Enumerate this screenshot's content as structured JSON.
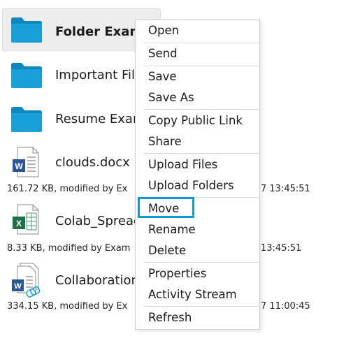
{
  "files": [
    {
      "name": "Folder Examp",
      "type": "folder",
      "selected": true
    },
    {
      "name": "Important File",
      "type": "folder"
    },
    {
      "name": "Resume Exam",
      "type": "folder"
    },
    {
      "name": "clouds.docx",
      "type": "word",
      "meta_left": "161.72 KB, modified by Ex",
      "meta_right": "7 13:45:51"
    },
    {
      "name": "Colab_Spread",
      "type": "excel",
      "meta_left": "8.33 KB, modified by Exam",
      "meta_right": "13:45:51"
    },
    {
      "name": "Collaboration",
      "type": "word-shared",
      "meta_left": "334.15 KB, modified by Ex",
      "meta_right": "7 11:00:45"
    }
  ],
  "context_menu": {
    "items": [
      "Open",
      "Send",
      "Save",
      "Save As",
      "Copy Public Link",
      "Share",
      "Upload Files",
      "Upload Folders",
      "Move",
      "Rename",
      "Delete",
      "Properties",
      "Activity Stream",
      "Refresh"
    ],
    "highlighted": "Move"
  },
  "colors": {
    "folder": "#1a9fd9",
    "folder_dark": "#0f86bd",
    "word": "#2b5797",
    "excel": "#1e7145",
    "highlight": "#0e9ad7",
    "selected_row": "#ededed"
  },
  "icons": {
    "folder": "folder-icon",
    "word": "word-doc-icon",
    "excel": "excel-sheet-icon",
    "shared": "shared-link-icon"
  }
}
